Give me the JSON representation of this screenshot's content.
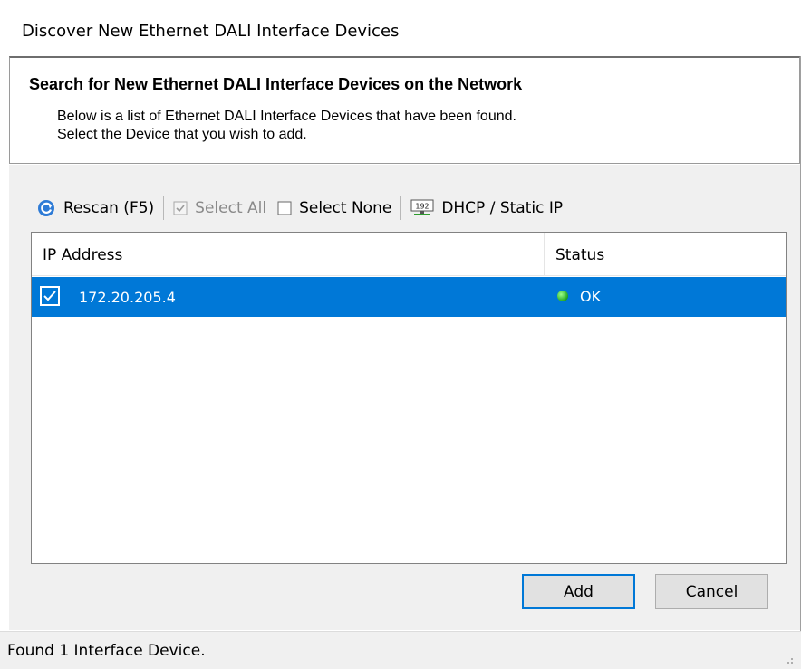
{
  "window": {
    "title": "Discover New Ethernet DALI Interface Devices"
  },
  "header": {
    "title": "Search for New Ethernet DALI Interface Devices on the Network",
    "line1": "Below is a list of Ethernet DALI Interface Devices that have been found.",
    "line2": "Select the Device that you wish to add."
  },
  "toolbar": {
    "rescan_label": "Rescan (F5)",
    "select_all_label": "Select All",
    "select_none_label": "Select None",
    "dhcp_label": "DHCP / Static IP",
    "dhcp_icon_text": "192"
  },
  "list": {
    "columns": [
      "IP Address",
      "Status"
    ],
    "rows": [
      {
        "ip": "172.20.205.4",
        "status": "OK",
        "checked": true,
        "status_color": "#1fa51f"
      }
    ]
  },
  "buttons": {
    "add_label": "Add",
    "cancel_label": "Cancel"
  },
  "statusbar": {
    "text": "Found 1 Interface Device."
  },
  "colors": {
    "selection": "#0078d7",
    "ok": "#1fa51f"
  }
}
